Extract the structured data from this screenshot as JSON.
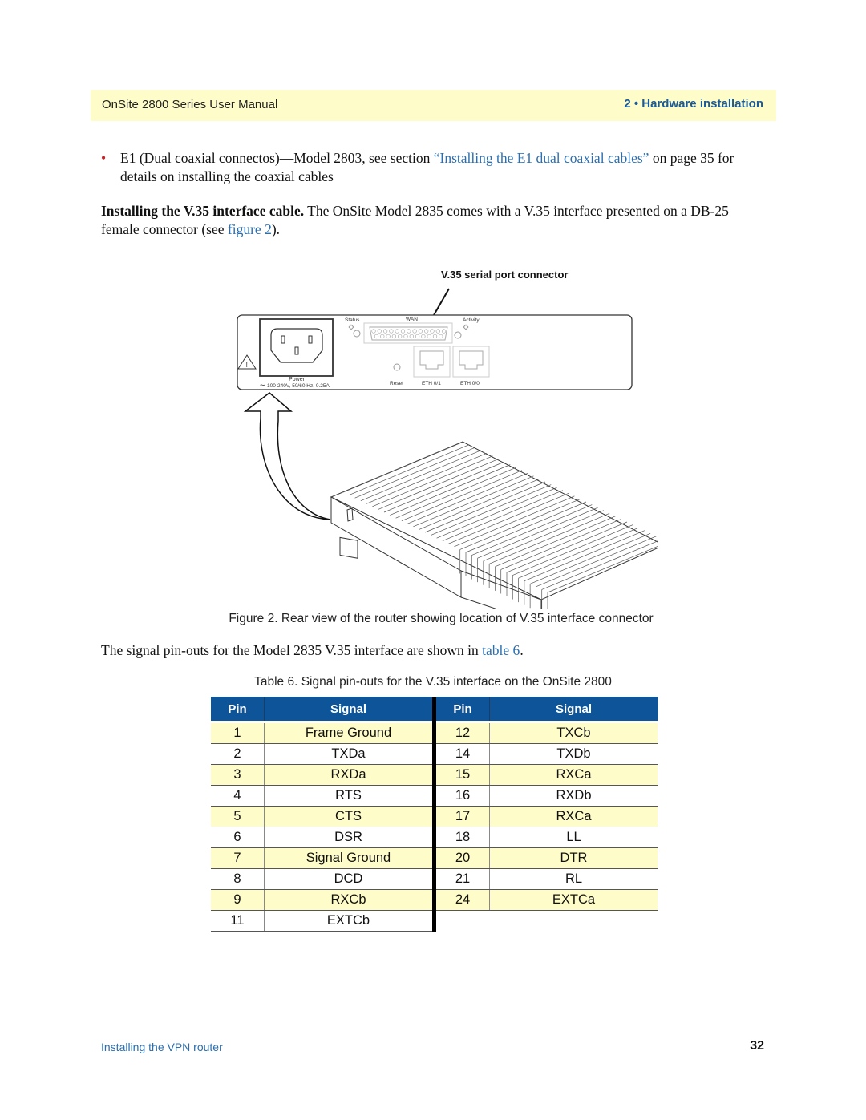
{
  "header": {
    "manual_title": "OnSite 2800 Series User Manual",
    "chapter": "2 • Hardware installation"
  },
  "body": {
    "bullet": {
      "text_before": "E1 (Dual coaxial connectos)—Model 2803, see section ",
      "link": "“Installing the E1 dual coaxial cables”",
      "text_after": " on page 35 for details on installing the coaxial cables"
    },
    "v35_para": {
      "heading": "Installing the V.35 interface cable.",
      "text_before": " The OnSite Model 2835 comes with a V.35 interface presented on a DB-25 female connector (see ",
      "link": "figure 2",
      "text_after": ")."
    },
    "pinouts_para": {
      "text_before": "The signal pin-outs for the Model 2835 V.35 interface are shown in ",
      "link": "table 6",
      "text_after": "."
    }
  },
  "figure": {
    "callout": "V.35 serial port connector",
    "labels": {
      "status": "Status",
      "wan": "WAN",
      "activity": "Activity",
      "power": "Power",
      "power_rating": "100-240V, 50/60 Hz, 0.25A",
      "reset": "Reset",
      "eth01": "ETH 0/1",
      "eth00": "ETH 0/0",
      "warning": "!"
    },
    "caption": "Figure 2. Rear view of the router showing location of V.35 interface connector"
  },
  "table": {
    "caption": "Table 6. Signal pin-outs for the V.35 interface on the OnSite 2800",
    "headers": [
      "Pin",
      "Signal",
      "Pin",
      "Signal"
    ],
    "rows": [
      {
        "pin1": "1",
        "sig1": "Frame Ground",
        "pin2": "12",
        "sig2": "TXCb"
      },
      {
        "pin1": "2",
        "sig1": "TXDa",
        "pin2": "14",
        "sig2": "TXDb"
      },
      {
        "pin1": "3",
        "sig1": "RXDa",
        "pin2": "15",
        "sig2": "RXCa"
      },
      {
        "pin1": "4",
        "sig1": "RTS",
        "pin2": "16",
        "sig2": "RXDb"
      },
      {
        "pin1": "5",
        "sig1": "CTS",
        "pin2": "17",
        "sig2": "RXCa"
      },
      {
        "pin1": "6",
        "sig1": "DSR",
        "pin2": "18",
        "sig2": "LL"
      },
      {
        "pin1": "7",
        "sig1": "Signal Ground",
        "pin2": "20",
        "sig2": "DTR"
      },
      {
        "pin1": "8",
        "sig1": "DCD",
        "pin2": "21",
        "sig2": "RL"
      },
      {
        "pin1": "9",
        "sig1": "RXCb",
        "pin2": "24",
        "sig2": "EXTCa"
      },
      {
        "pin1": "11",
        "sig1": "EXTCb",
        "pin2": "",
        "sig2": ""
      }
    ]
  },
  "footer": {
    "section": "Installing the VPN router",
    "page_number": "32"
  },
  "colors": {
    "header_bg": "#fefcc8",
    "accent_blue": "#1a5a9a",
    "link_blue": "#2a6fb0",
    "table_header": "#0d5499",
    "bullet_red": "#d21e1e"
  }
}
